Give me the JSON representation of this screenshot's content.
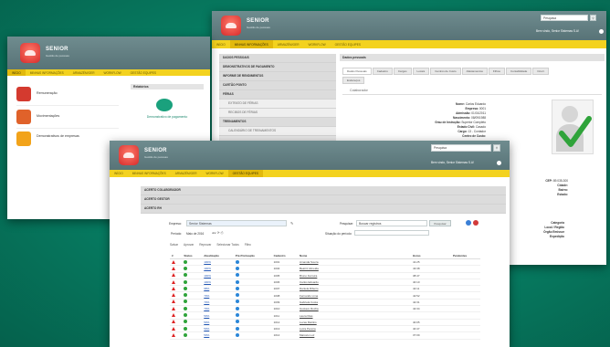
{
  "brand": {
    "name": "SENIOR",
    "tagline": "Gestão de pessoas"
  },
  "window_back": {
    "search_value": "Pesquisa",
    "welcome": "Bem vindo, Senior Sistemas S.A!",
    "nav": [
      "INÍCIO",
      "MINHAS INFORMAÇÕES",
      "ARMAZÉM/GER",
      "WORKFLOW",
      "GESTÃO EQUIPES"
    ],
    "sidebar": [
      {
        "label": "DADOS PESSOAIS",
        "type": "h"
      },
      {
        "label": "DEMONSTRATIVOS DE PAGAMENTO",
        "type": "h"
      },
      {
        "label": "INFORME DE RENDIMENTOS",
        "type": "h"
      },
      {
        "label": "CARTÃO PONTO",
        "type": "h"
      },
      {
        "label": "FÉRIAS",
        "type": "h"
      },
      {
        "label": "EXTRATO DE FÉRIAS",
        "type": "sub"
      },
      {
        "label": "RECIBOS DE FÉRIAS",
        "type": "sub"
      },
      {
        "label": "TREINAMENTOS",
        "type": "h"
      },
      {
        "label": "CALENDÁRIO DE TREINAMENTOS",
        "type": "sub"
      }
    ],
    "content_title": "Dados pessoais",
    "tabs": [
      "Dados Pessoais",
      "Cadastro",
      "Cargos",
      "Locais",
      "Centros de Custo",
      "Afastamentos",
      "Filhos",
      "Contabilidade",
      "Ocorr."
    ],
    "tab2": "Endereços",
    "section": "Colaborador",
    "fields": [
      {
        "k": "Nome:",
        "v": "Carlos Eduardo"
      },
      {
        "k": "Empresa:",
        "v": "0001"
      },
      {
        "k": "Admissão:",
        "v": "01/01/2011"
      },
      {
        "k": "Nascimento:",
        "v": "08/09/1988"
      },
      {
        "k": "Grau de Instrução:",
        "v": "Superior Completo"
      },
      {
        "k": "Estado Civil:",
        "v": "Casado"
      },
      {
        "k": "Cargo:",
        "v": "13 - Contador"
      },
      {
        "k": "Centro de Custo:",
        "v": ""
      }
    ],
    "right_fields": [
      {
        "k": "CEP:",
        "v": "89.035-300"
      },
      {
        "k": "Cidade:",
        "v": ""
      },
      {
        "k": "Bairro:",
        "v": ""
      },
      {
        "k": "Estado:",
        "v": ""
      }
    ],
    "right_fields2": [
      "Categoria",
      "Local / Região",
      "Órgão Emissor",
      "Expedição"
    ]
  },
  "window_left": {
    "nav": [
      "INÍCIO",
      "MINHAS INFORMAÇÕES",
      "ARMAZÉM/GER",
      "WORKFLOW",
      "GESTÃO EQUIPES"
    ],
    "items": [
      {
        "label": "Remuneração",
        "color": "#d43a2f"
      },
      {
        "label": "Movimentações",
        "color": "#e0622a"
      },
      {
        "label": "Demonstrativos de empresas",
        "color": "#f2a31a"
      }
    ],
    "panel_title": "Relatórios",
    "panel_caption": "Demonstrativo de pagamento"
  },
  "window_front": {
    "search_value": "Pesquisa",
    "welcome": "Bem vindo, Senior Sistemas S.A!",
    "nav": [
      "INÍCIO",
      "MINHAS INFORMAÇÕES",
      "ARMAZÉM/GER",
      "WORKFLOW",
      "GESTÃO EQUIPES"
    ],
    "sections": [
      "ACERTO COLABORADOR",
      "ACERTO GESTOR",
      "ACERTO RH"
    ],
    "toolbar": {
      "filter_label": "Empresa:",
      "filter_value": "Senior Sistemas",
      "search_label": "Pesquisar:",
      "search_value": "Buscar registros",
      "search_btn": "Pesquisar",
      "period_label": "Período:",
      "period_value": "Maio de 2016",
      "situation_label": "Situação do período:",
      "actions": [
        "Salvar",
        "Aprovar",
        "Reprovar",
        "Selecionar Todos",
        "Filtro"
      ]
    },
    "columns": [
      "#",
      "Status",
      "Atualização",
      "Pré-Pontuação",
      "Cadastro",
      "Nome",
      "Horas",
      "Pendentes"
    ],
    "rows": [
      {
        "pct": "100%",
        "cad": "1001",
        "name": "Amanda Souza",
        "hours": "41:25"
      },
      {
        "pct": "100%",
        "cad": "1004",
        "name": "Beatriz Almeida",
        "hours": "43:38"
      },
      {
        "pct": "100%",
        "cad": "1005",
        "name": "Bruno Ferreira",
        "hours": "38:47"
      },
      {
        "pct": "100%",
        "cad": "1006",
        "name": "Carlos Eduardo",
        "hours": "40:10"
      },
      {
        "pct": "98%",
        "cad": "1007",
        "name": "Daniela Ribeiro",
        "hours": "42:11"
      },
      {
        "pct": "70%",
        "cad": "1008",
        "name": "Fernando Lima",
        "hours": "42:52"
      },
      {
        "pct": "70%",
        "cad": "1009",
        "name": "Gabriela Costa",
        "hours": "42:31"
      },
      {
        "pct": "70%",
        "cad": "1010",
        "name": "Gustavo Rocha",
        "hours": "42:34"
      },
      {
        "pct": "50%",
        "cad": "1011",
        "name": "Laura Dias",
        "hours": ""
      },
      {
        "pct": "50%",
        "cad": "1012",
        "name": "Lucas Martins",
        "hours": "40:05"
      },
      {
        "pct": "50%",
        "cad": "1013",
        "name": "Luiza Pereira",
        "hours": "40:47"
      },
      {
        "pct": "50%",
        "cad": "1014",
        "name": "Marcelo Luz",
        "hours": "37:09"
      }
    ]
  }
}
